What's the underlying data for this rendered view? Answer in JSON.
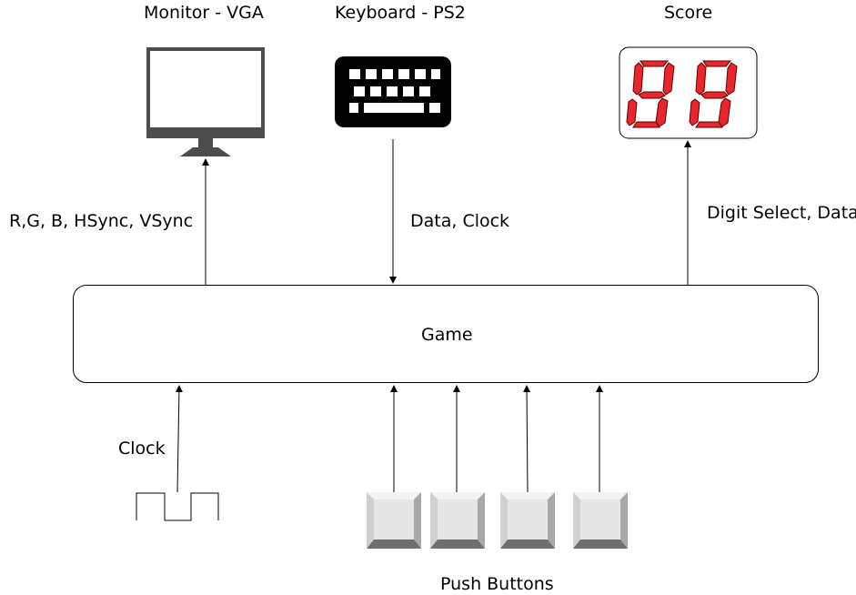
{
  "labels": {
    "monitor": "Monitor - VGA",
    "keyboard": "Keyboard - PS2",
    "score": "Score",
    "vga_signals": "R,G, B, HSync, VSync",
    "ps2_signals": "Data, Clock",
    "score_signals": "Digit Select, Data",
    "game": "Game",
    "clock": "Clock",
    "push_buttons": "Push Buttons"
  },
  "icons": {
    "monitor": "monitor-icon",
    "keyboard": "keyboard-icon",
    "score_display": "seven-segment-display-icon",
    "clock_wave": "clock-waveform-icon",
    "push_button": "push-button-icon"
  },
  "colors": {
    "segment_red": "#e8262b",
    "monitor_gray": "#4d4d4d",
    "keyboard_black": "#000000",
    "button_face": "#e6e6e6"
  }
}
